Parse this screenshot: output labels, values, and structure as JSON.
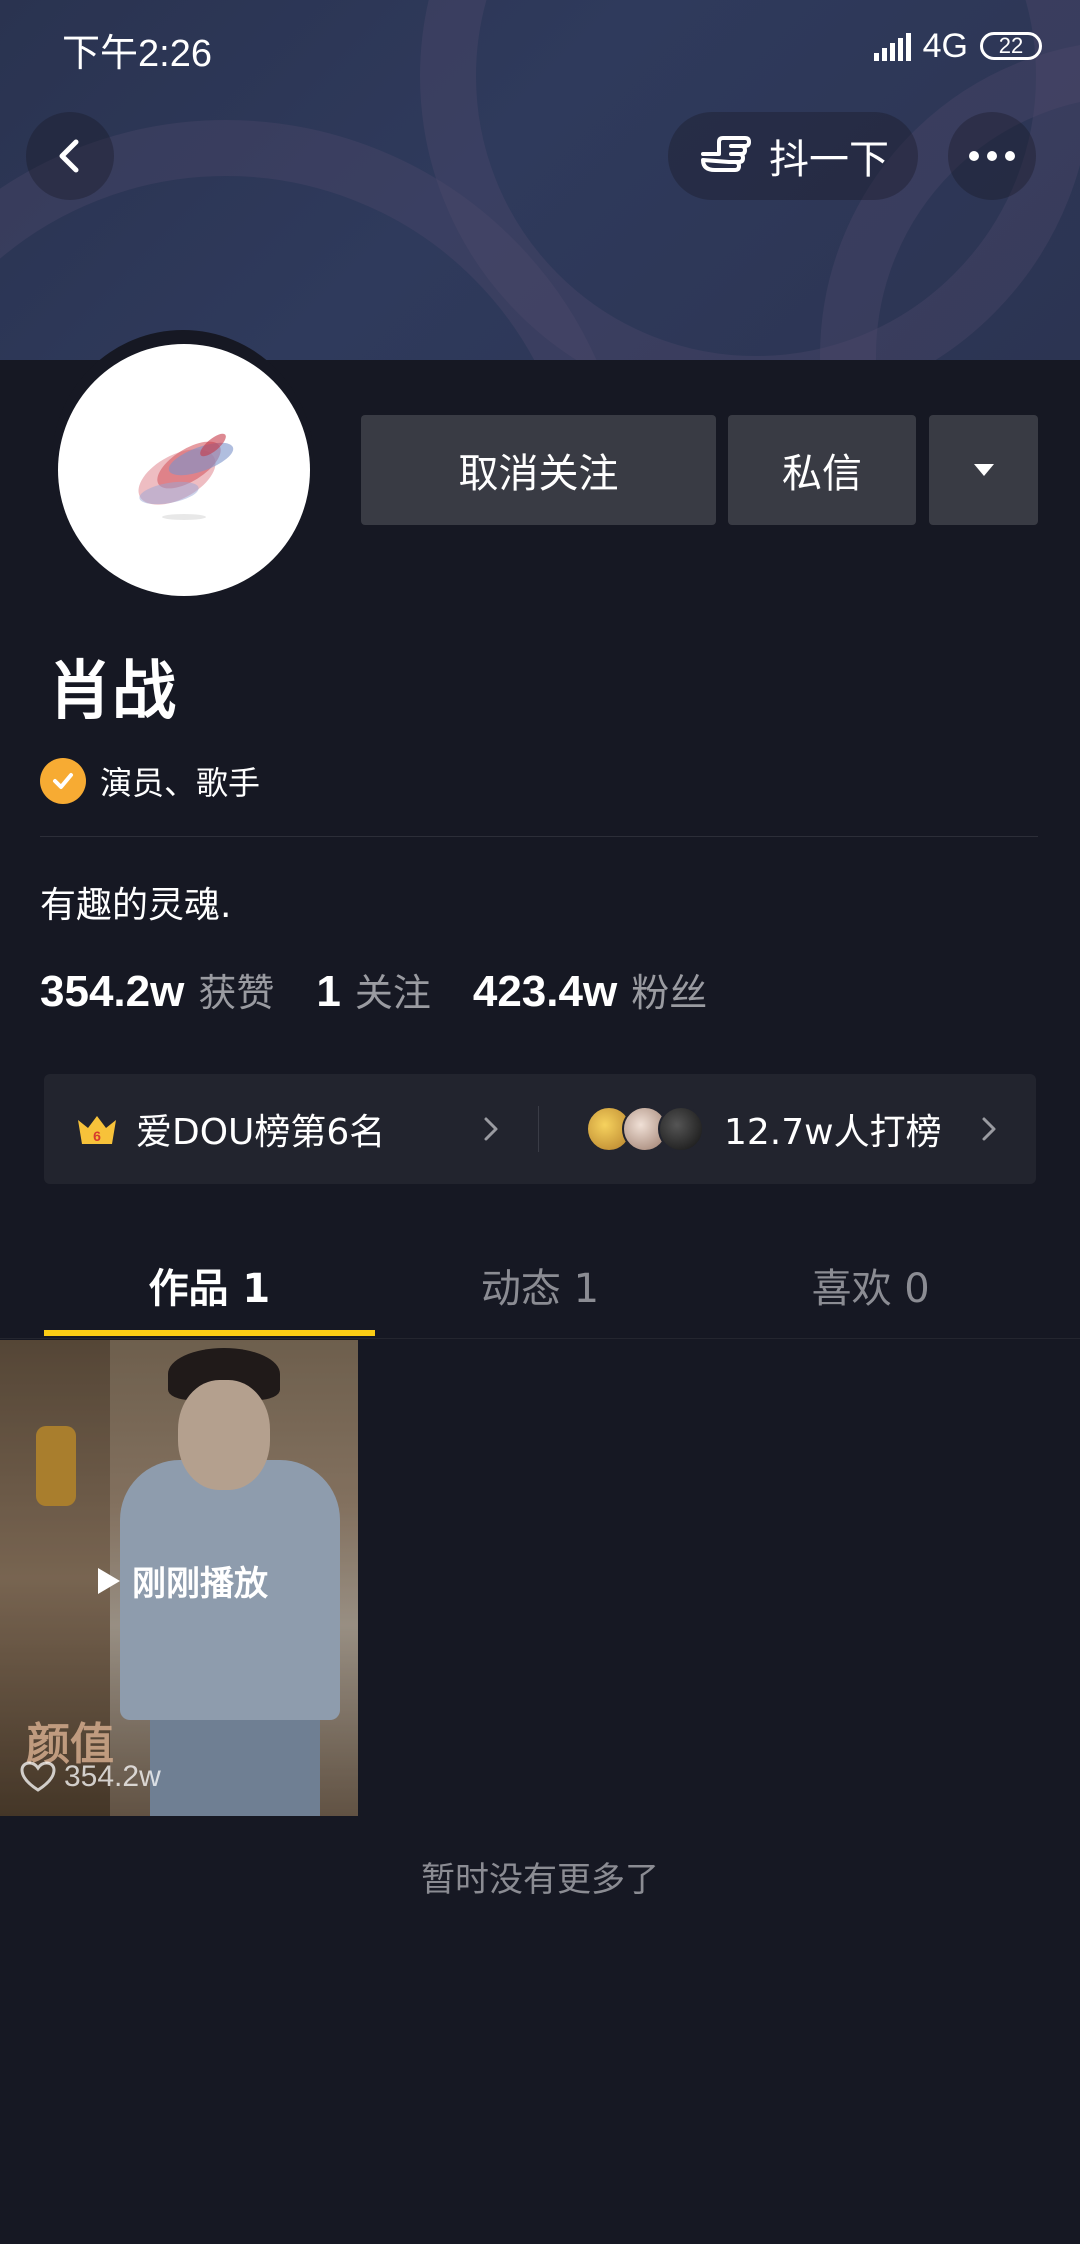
{
  "status_bar": {
    "time": "下午2:26",
    "network": "4G",
    "battery": "22"
  },
  "header": {
    "shake_label": "抖一下",
    "icons": [
      "back-icon",
      "hand-pointer-icon",
      "more-icon"
    ]
  },
  "profile": {
    "name": "肖战",
    "verify_text": "演员、歌手",
    "bio": "有趣的灵魂.",
    "actions": {
      "unfollow_label": "取消关注",
      "message_label": "私信"
    },
    "stats": [
      {
        "value": "354.2w",
        "label": "获赞"
      },
      {
        "value": "1",
        "label": "关注"
      },
      {
        "value": "423.4w",
        "label": "粉丝"
      }
    ]
  },
  "rank": {
    "badge_number": "6",
    "rank_text": "爱DOU榜第6名",
    "supporters_text": "12.7w人打榜"
  },
  "tabs": [
    {
      "label": "作品 1",
      "active": true
    },
    {
      "label": "动态 1",
      "active": false
    },
    {
      "label": "喜欢 0",
      "active": false
    }
  ],
  "videos": [
    {
      "play_status": "刚刚播放",
      "watermark": "颜值",
      "likes": "354.2w"
    }
  ],
  "footer": {
    "no_more_text": "暂时没有更多了"
  },
  "colors": {
    "background": "#161823",
    "button": "#393b44",
    "tab_indicator": "#facc15",
    "verify_badge": "#f7ab33"
  }
}
